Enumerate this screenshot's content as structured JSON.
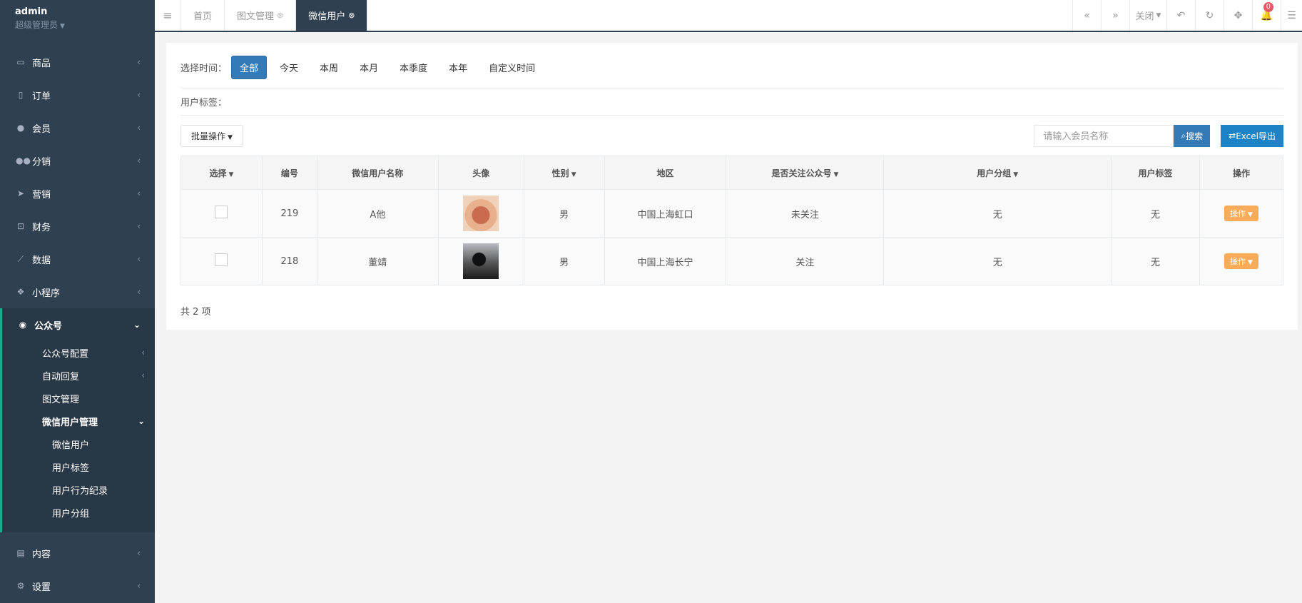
{
  "profile": {
    "name": "admin",
    "role": "超级管理员"
  },
  "nav": [
    {
      "label": "商品",
      "icon": "laptop-icon"
    },
    {
      "label": "订单",
      "icon": "document-icon"
    },
    {
      "label": "会员",
      "icon": "user-icon"
    },
    {
      "label": "分销",
      "icon": "users-icon"
    },
    {
      "label": "营销",
      "icon": "paper-plane-icon"
    },
    {
      "label": "财务",
      "icon": "money-icon"
    },
    {
      "label": "数据",
      "icon": "line-chart-icon"
    },
    {
      "label": "小程序",
      "icon": "cubes-icon"
    },
    {
      "label": "公众号",
      "icon": "wechat-icon"
    }
  ],
  "submenu": {
    "config": "公众号配置",
    "autoreply": "自动回复",
    "news": "图文管理",
    "usermgmt": "微信用户管理",
    "sub": [
      "微信用户",
      "用户标签",
      "用户行为纪录",
      "用户分组"
    ]
  },
  "nav_bottom": [
    {
      "label": "内容",
      "icon": "book-icon"
    },
    {
      "label": "设置",
      "icon": "gear-icon"
    }
  ],
  "tabs": [
    {
      "label": "首页"
    },
    {
      "label": "图文管理"
    },
    {
      "label": "微信用户"
    }
  ],
  "topbar": {
    "close_label": "关闭",
    "notifications": "0"
  },
  "filter": {
    "label": "选择时间：",
    "options": [
      "全部",
      "今天",
      "本周",
      "本月",
      "本季度",
      "本年",
      "自定义时间"
    ]
  },
  "tag_label": "用户标签：",
  "batch_label": "批量操作",
  "search": {
    "placeholder": "请输入会员名称",
    "button": "搜索"
  },
  "excel_label": "Excel导出",
  "columns": [
    "选择",
    "编号",
    "微信用户名称",
    "头像",
    "性别",
    "地区",
    "是否关注公众号",
    "用户分组",
    "用户标签",
    "操作"
  ],
  "rows": [
    {
      "id": "219",
      "name": "A他",
      "gender": "男",
      "region": "中国上海虹口",
      "follow": "未关注",
      "group": "无",
      "tag": "无",
      "action": "操作"
    },
    {
      "id": "218",
      "name": "董靖",
      "gender": "男",
      "region": "中国上海长宁",
      "follow": "关注",
      "group": "无",
      "tag": "无",
      "action": "操作"
    }
  ],
  "total": "共 2 项",
  "colors": {
    "sidebar": "#2f4050",
    "primary": "#337ab7",
    "excel": "#1c84c6",
    "warning": "#f8ac59",
    "badge": "#ed5565"
  }
}
